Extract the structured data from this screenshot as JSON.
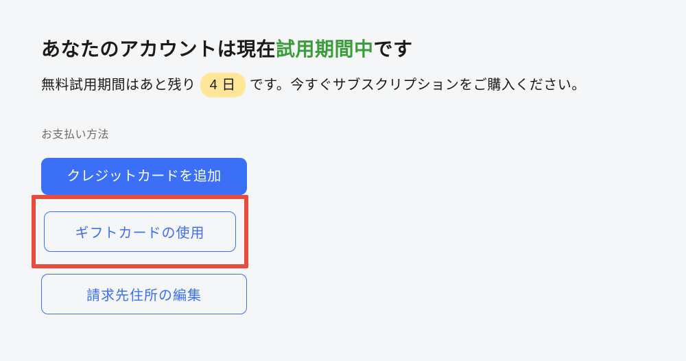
{
  "heading": {
    "prefix": "あなたのアカウントは現在",
    "highlight": "試用期間中",
    "suffix": "です"
  },
  "description": {
    "before_badge": "無料試用期間はあと残り",
    "days_badge": "4 日",
    "after_badge": "です。今すぐサブスクリプションをご購入ください。"
  },
  "payment_section": {
    "label": "お支払い方法",
    "buttons": {
      "add_credit_card": "クレジットカードを追加",
      "use_gift_card": "ギフトカードの使用",
      "edit_billing_address": "請求先住所の編集"
    }
  }
}
